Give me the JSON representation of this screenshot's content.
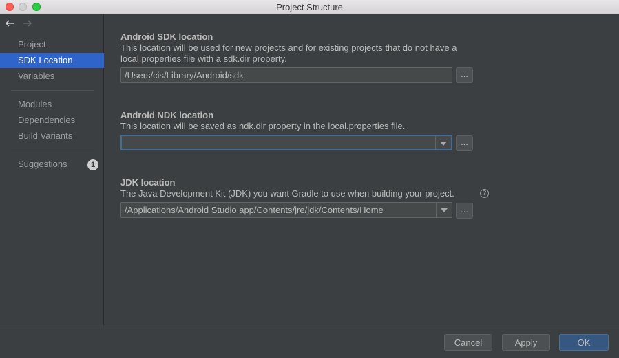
{
  "window": {
    "title": "Project Structure"
  },
  "sidebar": {
    "items": [
      {
        "label": "Project"
      },
      {
        "label": "SDK Location"
      },
      {
        "label": "Variables"
      },
      {
        "label": "Modules"
      },
      {
        "label": "Dependencies"
      },
      {
        "label": "Build Variants"
      },
      {
        "label": "Suggestions",
        "badge": "1"
      }
    ]
  },
  "sdk": {
    "title": "Android SDK location",
    "description": "This location will be used for new projects and for existing projects that do not have a local.properties file with a sdk.dir property.",
    "value": "/Users/cis/Library/Android/sdk",
    "browse_label": "..."
  },
  "ndk": {
    "title": "Android NDK location",
    "description": "This location will be saved as ndk.dir property in the local.properties file.",
    "value": "",
    "browse_label": "..."
  },
  "jdk": {
    "title": "JDK location",
    "description": "The Java Development Kit (JDK) you want Gradle to use when building your project.",
    "help": "?",
    "value": "/Applications/Android Studio.app/Contents/jre/jdk/Contents/Home",
    "browse_label": "..."
  },
  "footer": {
    "cancel_label": "Cancel",
    "apply_label": "Apply",
    "ok_label": "OK"
  },
  "colors": {
    "selection": "#2f65ca",
    "primary_button": "#365880",
    "focus_border": "#466d94"
  }
}
